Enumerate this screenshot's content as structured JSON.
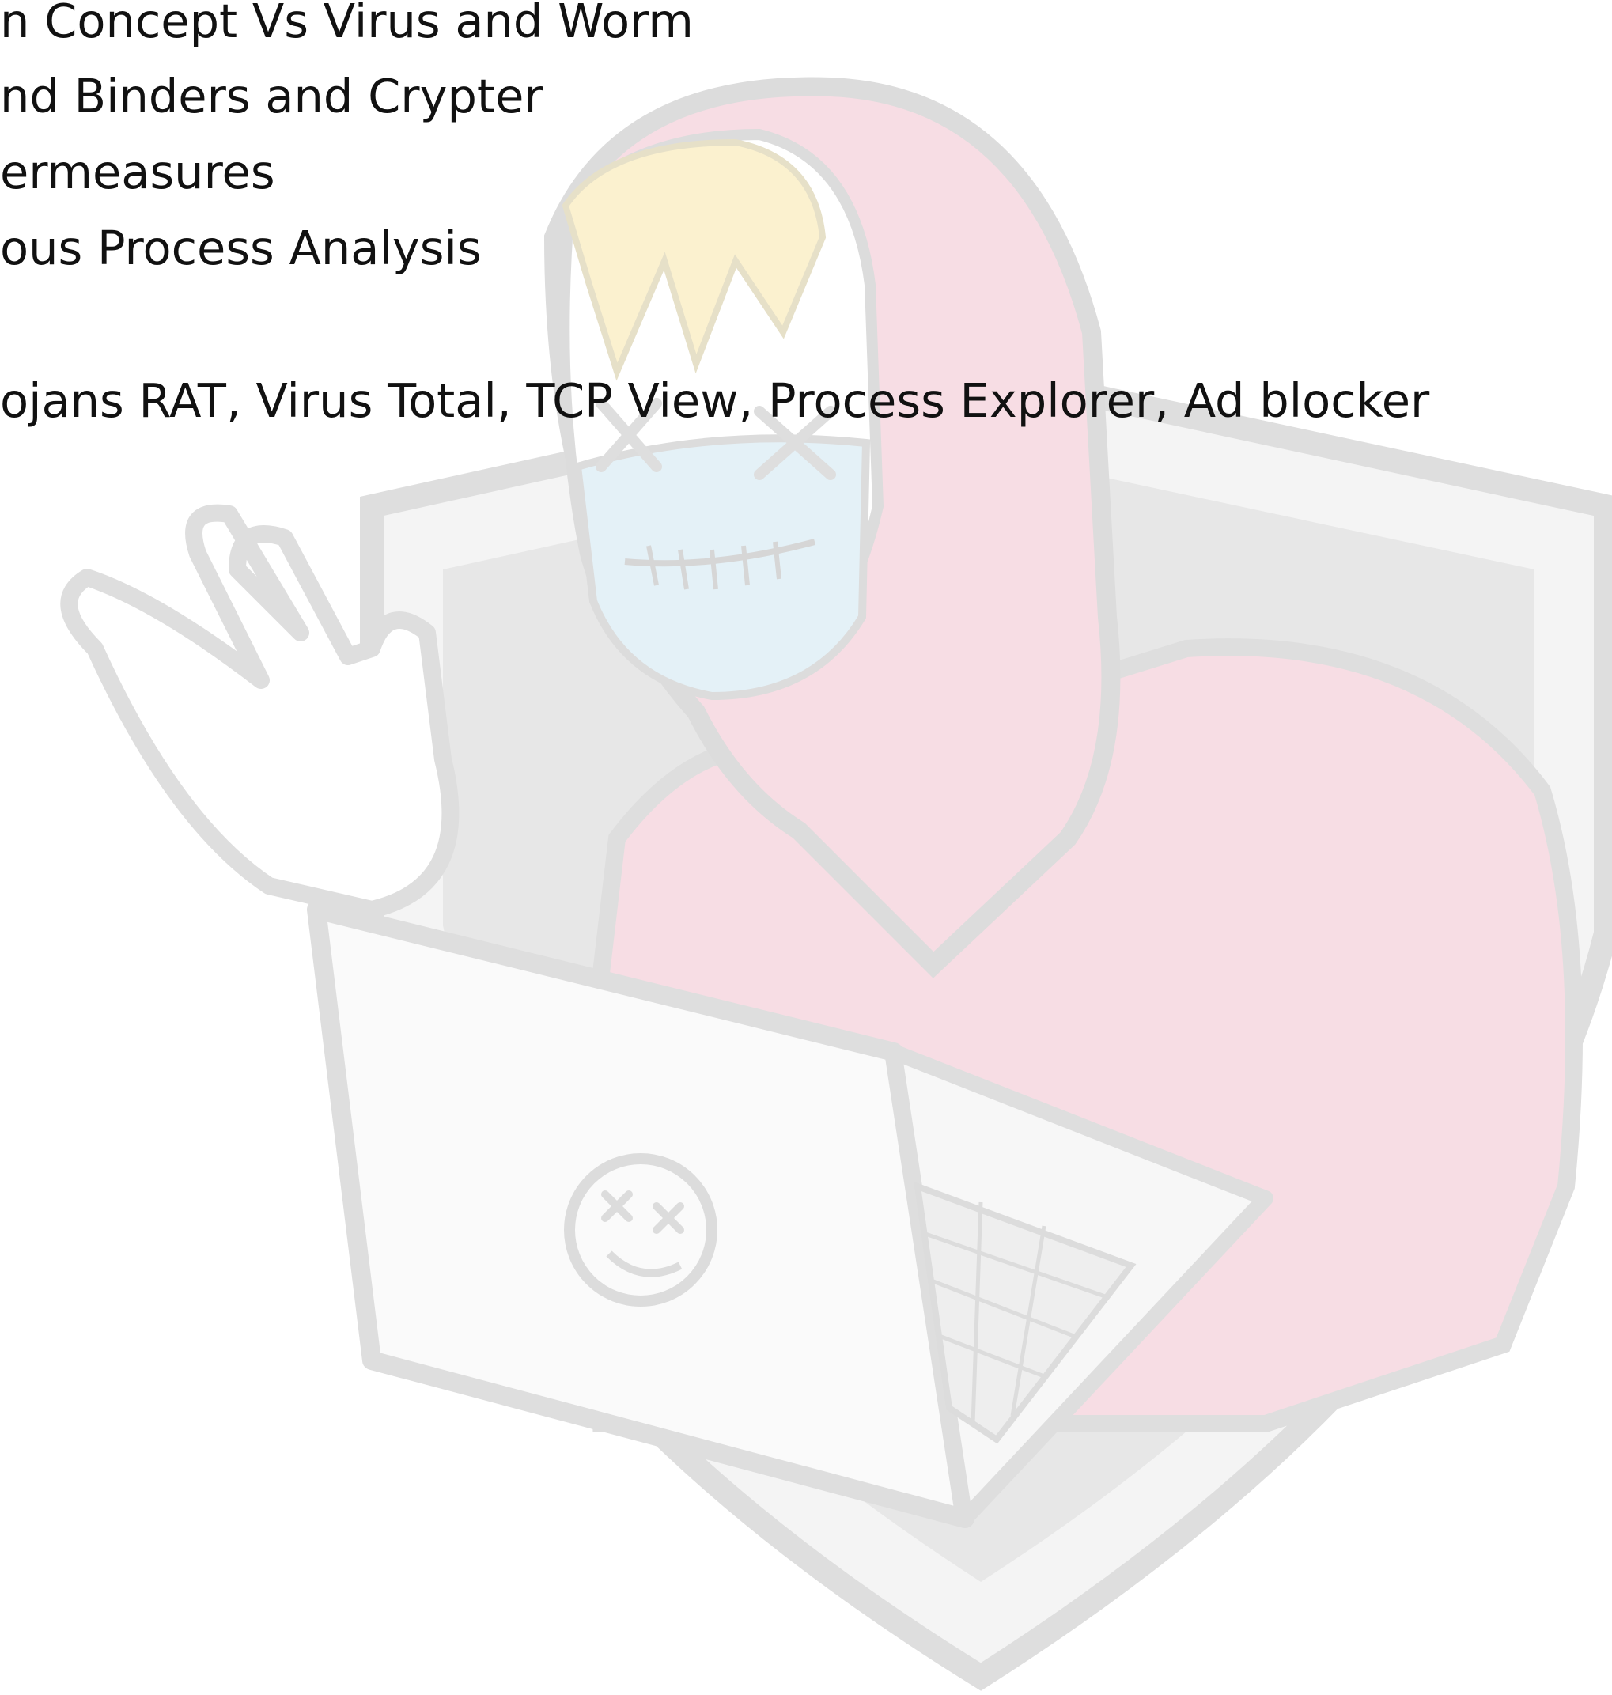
{
  "lines": [
    "n Concept Vs Virus and Worm",
    "nd Binders and Crypter",
    "ermeasures",
    "ous Process Analysis",
    "ojans RAT, Virus Total, TCP View, Process Explorer, Ad blocker"
  ],
  "watermark": {
    "icon": "hacker-mascot-icon",
    "colors": {
      "hoodie": "#f7dde4",
      "hoodie_outline": "#dcdcdc",
      "hair": "#fbf1cf",
      "mask": "#e4f1f7",
      "shield_dark": "#e6e6e6",
      "shield_light": "#f4f4f4",
      "laptop": "#fafafa"
    }
  }
}
